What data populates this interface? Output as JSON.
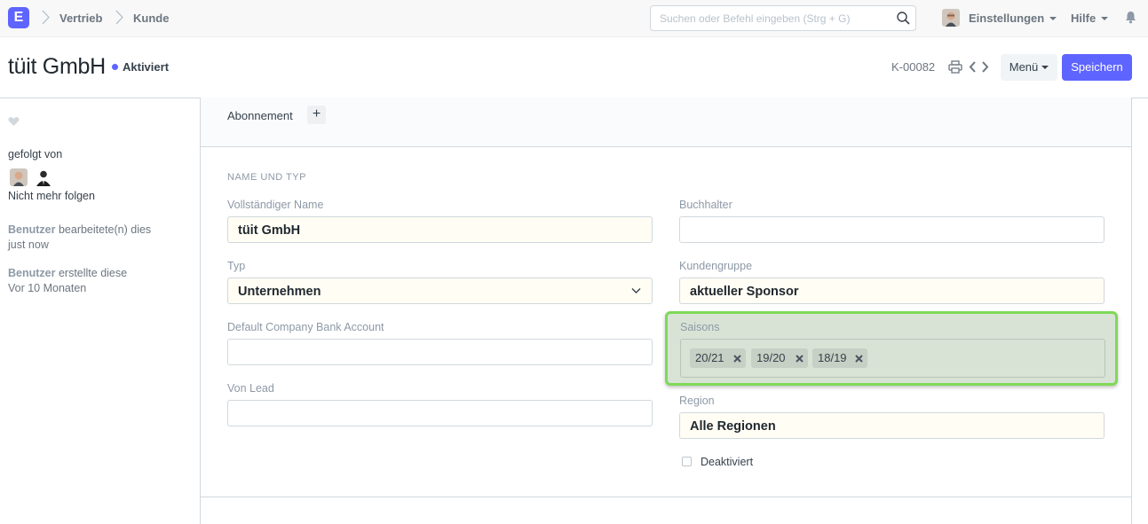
{
  "navbar": {
    "logo_letter": "E",
    "breadcrumbs": [
      "Vertrieb",
      "Kunde"
    ],
    "search_placeholder": "Suchen oder Befehl eingeben (Strg + G)",
    "settings_label": "Einstellungen",
    "help_label": "Hilfe"
  },
  "page": {
    "title": "tüit GmbH",
    "status": "Aktiviert",
    "status_color": "#5e64ff",
    "doc_id": "K-00082",
    "menu_label": "Menü",
    "save_label": "Speichern",
    "accent_color": "#5e64ff"
  },
  "sidebar": {
    "followed_by": "gefolgt von",
    "unfollow": "Nicht mehr folgen",
    "activity": [
      {
        "user": "Benutzer",
        "action": " bearbeitete(n) dies",
        "time": "just now"
      },
      {
        "user": "Benutzer",
        "action": " erstellte diese",
        "time": "Vor 10 Monaten"
      }
    ]
  },
  "form": {
    "subscription_label": "Abonnement",
    "add_symbol": "+",
    "section_title": "NAME UND TYP",
    "fields": {
      "full_name": {
        "label": "Vollständiger Name",
        "value": "tüit GmbH"
      },
      "type": {
        "label": "Typ",
        "value": "Unternehmen"
      },
      "bank_account": {
        "label": "Default Company Bank Account",
        "value": ""
      },
      "from_lead": {
        "label": "Von Lead",
        "value": ""
      },
      "accountant": {
        "label": "Buchhalter",
        "value": ""
      },
      "customer_group": {
        "label": "Kundengruppe",
        "value": "aktueller Sponsor"
      },
      "seasons": {
        "label": "Saisons",
        "tags": [
          "20/21",
          "19/20",
          "18/19"
        ]
      },
      "region": {
        "label": "Region",
        "value": "Alle Regionen"
      },
      "disabled": {
        "label": "Deaktiviert",
        "checked": false
      }
    },
    "highlight_color": "#7ed957"
  }
}
